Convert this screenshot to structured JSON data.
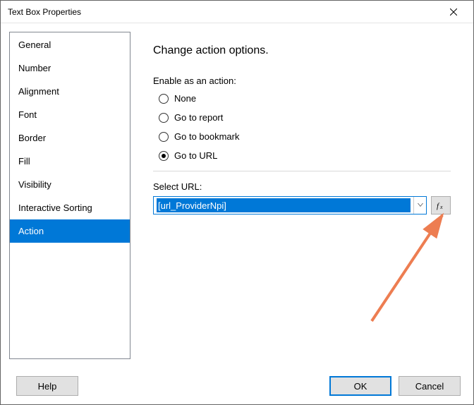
{
  "window": {
    "title": "Text Box Properties"
  },
  "sidebar": {
    "items": [
      {
        "label": "General"
      },
      {
        "label": "Number"
      },
      {
        "label": "Alignment"
      },
      {
        "label": "Font"
      },
      {
        "label": "Border"
      },
      {
        "label": "Fill"
      },
      {
        "label": "Visibility"
      },
      {
        "label": "Interactive Sorting"
      },
      {
        "label": "Action"
      }
    ],
    "selected_index": 8
  },
  "content": {
    "heading": "Change action options.",
    "enable_label": "Enable as an action:",
    "radios": [
      {
        "label": "None"
      },
      {
        "label": "Go to report"
      },
      {
        "label": "Go to bookmark"
      },
      {
        "label": "Go to URL"
      }
    ],
    "selected_radio_index": 3,
    "select_url_label": "Select URL:",
    "select_url_value": "[url_ProviderNpi]"
  },
  "footer": {
    "help": "Help",
    "ok": "OK",
    "cancel": "Cancel"
  }
}
